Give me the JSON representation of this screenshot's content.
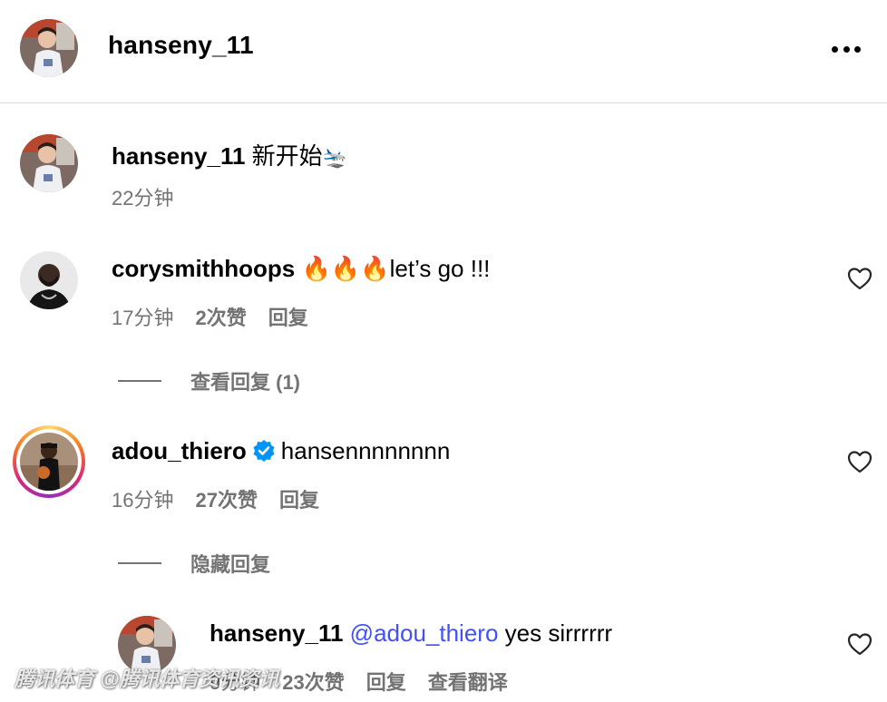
{
  "header": {
    "username": "hansenу_11",
    "more_icon": "more-horizontal-icon"
  },
  "caption": {
    "username": "hanseny_11",
    "text": "新开始",
    "emoji": "🛬",
    "time": "22分钟"
  },
  "comments": [
    {
      "username": "corysmithhoops",
      "text": "🔥🔥🔥let’s go !!!",
      "time": "17分钟",
      "likes": "2次赞",
      "reply": "回复",
      "thread_toggle": "查看回复 (1)"
    },
    {
      "username": "adou_thiero",
      "verified": true,
      "text": "hansennnnnnnn",
      "time": "16分钟",
      "likes": "27次赞",
      "reply": "回复",
      "thread_toggle": "隐藏回复"
    }
  ],
  "reply": {
    "username": "hanseny_11",
    "mention": "@adou_thiero",
    "text": "yes sirrrrrr",
    "time": "9分钟",
    "likes": "23次赞",
    "reply": "回复",
    "translate": "查看翻译"
  },
  "watermark": "腾讯体育 @腾讯体育资讯资讯",
  "colors": {
    "mention": "#4150f7",
    "secondary_text": "#737373",
    "verified": "#0095f6",
    "divider": "#dbdbdb"
  }
}
